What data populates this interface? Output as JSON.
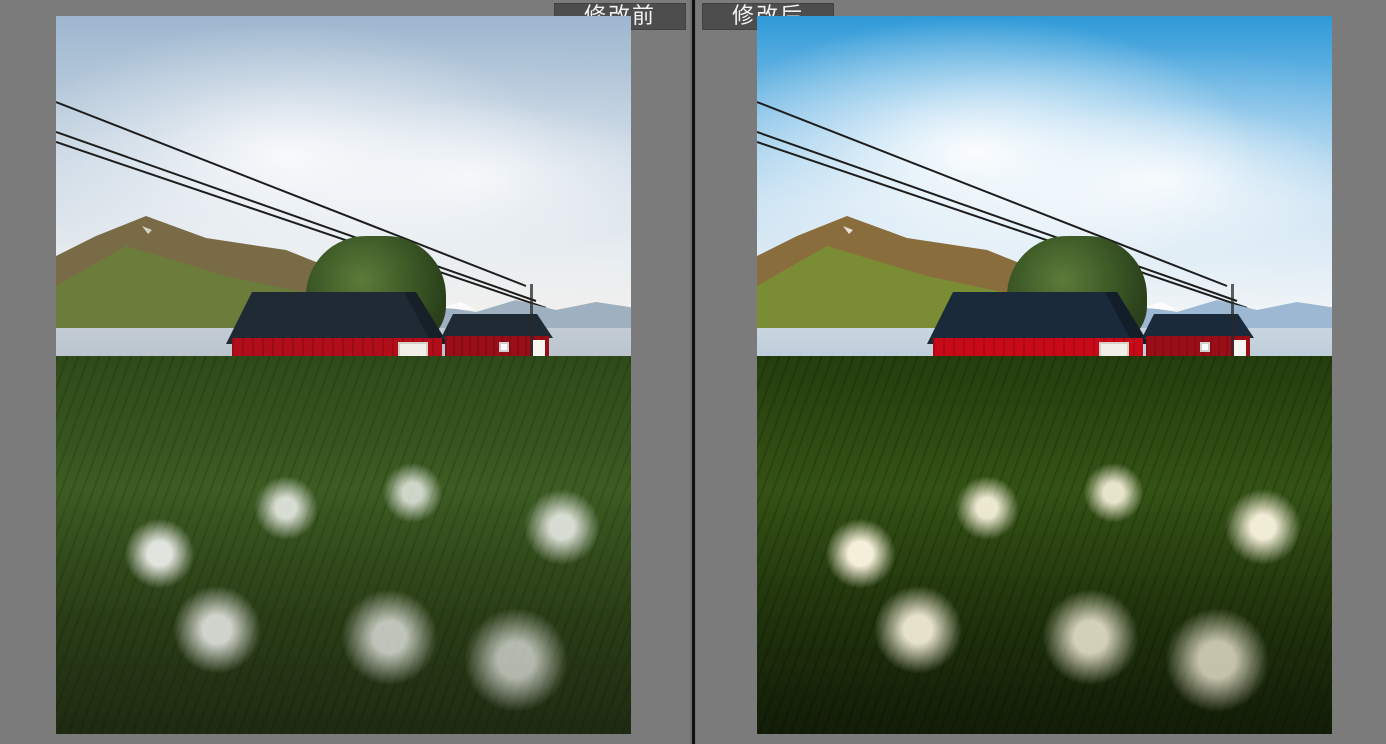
{
  "comparison": {
    "before_label": "修改前",
    "after_label": "修改后"
  },
  "images": {
    "before_name": "before-photo",
    "after_name": "after-photo"
  },
  "colors": {
    "window_background": "#7a7a7a",
    "label_background": "#4d4d4d",
    "label_text": "#f2f2f2",
    "divider_line": "#111111"
  }
}
